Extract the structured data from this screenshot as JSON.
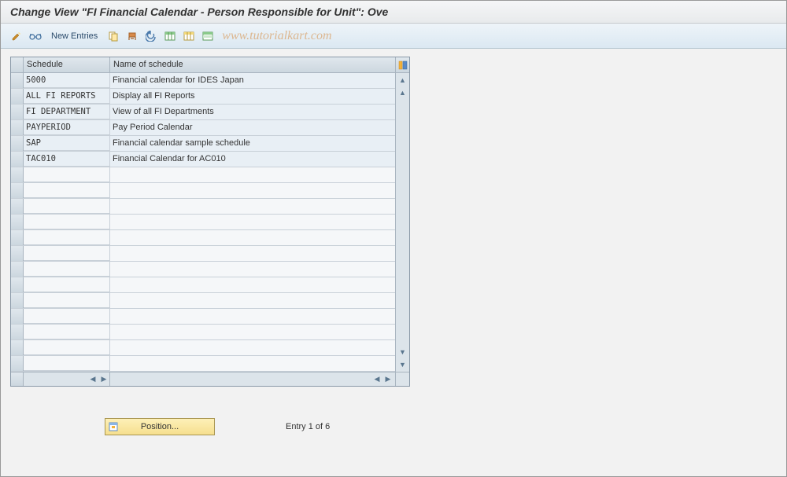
{
  "title": "Change View \"FI Financial Calendar - Person Responsible for Unit\": Ove",
  "toolbar": {
    "new_entries_label": "New Entries",
    "watermark": "www.tutorialkart.com"
  },
  "table": {
    "headers": {
      "col1": "Schedule",
      "col2": "Name of schedule"
    },
    "rows": [
      {
        "schedule": "5000",
        "name": "Financial calendar for IDES Japan"
      },
      {
        "schedule": "ALL FI REPORTS",
        "name": "Display all FI Reports"
      },
      {
        "schedule": "FI DEPARTMENT",
        "name": "View of all FI Departments"
      },
      {
        "schedule": "PAYPERIOD",
        "name": "Pay Period Calendar"
      },
      {
        "schedule": "SAP",
        "name": "Financial calendar sample schedule"
      },
      {
        "schedule": "TAC010",
        "name": "Financial Calendar for AC010"
      },
      {
        "schedule": "",
        "name": ""
      },
      {
        "schedule": "",
        "name": ""
      },
      {
        "schedule": "",
        "name": ""
      },
      {
        "schedule": "",
        "name": ""
      },
      {
        "schedule": "",
        "name": ""
      },
      {
        "schedule": "",
        "name": ""
      },
      {
        "schedule": "",
        "name": ""
      },
      {
        "schedule": "",
        "name": ""
      },
      {
        "schedule": "",
        "name": ""
      },
      {
        "schedule": "",
        "name": ""
      },
      {
        "schedule": "",
        "name": ""
      },
      {
        "schedule": "",
        "name": ""
      },
      {
        "schedule": "",
        "name": ""
      }
    ]
  },
  "footer": {
    "position_label": "Position...",
    "entry_text": "Entry 1 of 6"
  }
}
